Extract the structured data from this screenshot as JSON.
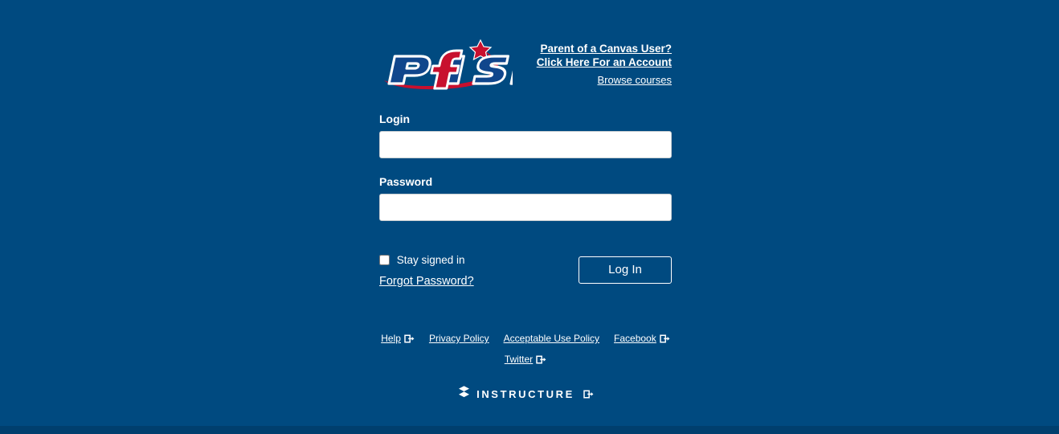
{
  "theme": {
    "background": "#004a80",
    "bottom_strip": "#003f6e",
    "text": "#ffffff",
    "logo_blue": "#10468c",
    "logo_red": "#c8102e",
    "input_background": "#ffffff",
    "input_border": "#c7cdd1"
  },
  "logo": {
    "name": "PfISD",
    "alt_text": "PfISD"
  },
  "header": {
    "parent_account_link": "Parent of a Canvas User? Click Here For an Account",
    "parent_account_line1": "Parent of a Canvas User?",
    "parent_account_line2": "Click Here For an Account",
    "browse_courses": "Browse courses"
  },
  "form": {
    "login_label": "Login",
    "login_value": "",
    "login_placeholder": "",
    "password_label": "Password",
    "password_value": "",
    "password_placeholder": "",
    "stay_signed_in_label": "Stay signed in",
    "stay_signed_in_checked": false,
    "forgot_password_label": "Forgot Password?",
    "log_in_button": "Log In"
  },
  "footer": {
    "links": [
      {
        "label": "Help",
        "external": true
      },
      {
        "label": "Privacy Policy",
        "external": false
      },
      {
        "label": "Acceptable Use Policy",
        "external": false
      },
      {
        "label": "Facebook",
        "external": true
      },
      {
        "label": "Twitter",
        "external": true
      }
    ],
    "instructure_label": "INSTRUCTURE"
  },
  "icons": {
    "external_link": "external-link-icon",
    "instructure_mark": "instructure-logo-icon",
    "star": "star-icon"
  }
}
